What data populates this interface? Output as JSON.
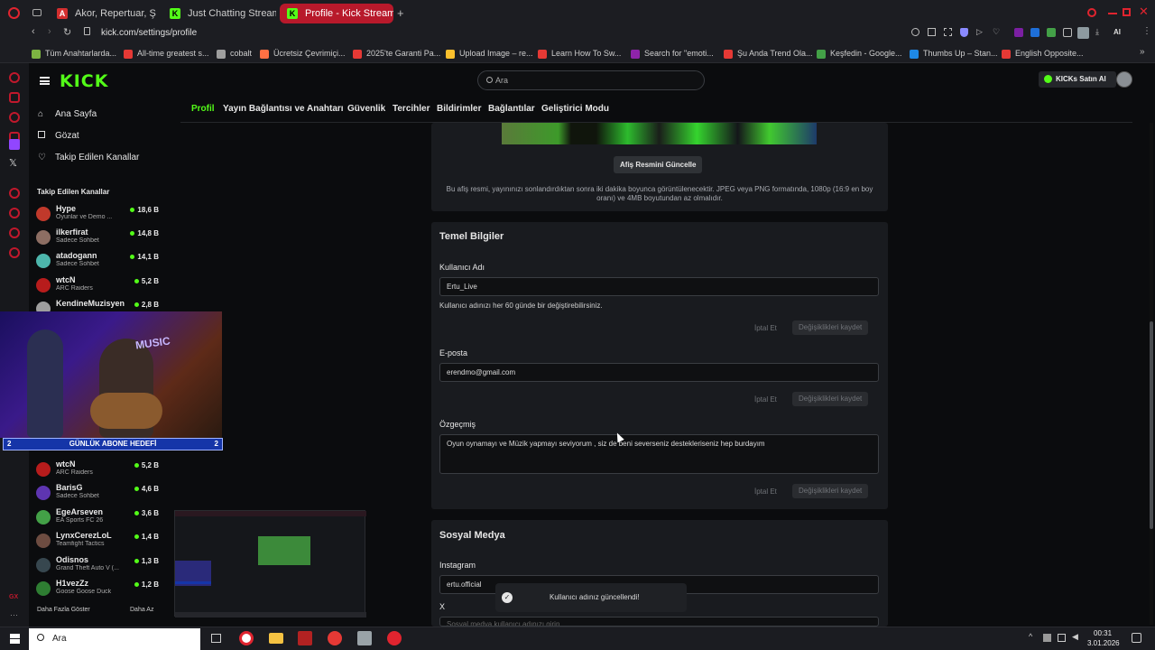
{
  "browser": {
    "tabs": [
      {
        "title": "Akor, Repertuar, Şarkı Söz",
        "icon": "a-icon",
        "color": "#d32f2f",
        "active": false
      },
      {
        "title": "Just Chatting Streaming -",
        "icon": "kick-icon",
        "color": "#53fc18",
        "active": false
      },
      {
        "title": "Profile - Kick Streaming",
        "icon": "kick-icon",
        "color": "#53fc18",
        "active": true
      }
    ],
    "url": "kick.com/settings/profile",
    "bookmarks": [
      {
        "label": "Tüm Anahtarlarda...",
        "color": "#7cb342"
      },
      {
        "label": "All-time greatest s...",
        "color": "#e53935"
      },
      {
        "label": "cobalt",
        "color": "#9e9e9e"
      },
      {
        "label": "Ücretsiz Çevrimiçi...",
        "color": "#ff7043"
      },
      {
        "label": "2025'te Garanti Pa...",
        "color": "#e53935"
      },
      {
        "label": "Upload Image – re...",
        "color": "#fbc02d"
      },
      {
        "label": "Learn How To Sw...",
        "color": "#e53935"
      },
      {
        "label": "Search for \"emoti...",
        "color": "#8e24aa"
      },
      {
        "label": "Şu Anda Trend Ola...",
        "color": "#e53935"
      },
      {
        "label": "Keşfedin - Google...",
        "color": "#43a047"
      },
      {
        "label": "Thumbs Up – Stan...",
        "color": "#1e88e5"
      },
      {
        "label": "English Opposite...",
        "color": "#e53935"
      }
    ],
    "extension_label": "AI"
  },
  "header": {
    "logo": "KICK",
    "search_placeholder": "Ara",
    "buy_kicks": "KICKs Satın Al"
  },
  "subnav": [
    "Profil",
    "Yayın Bağlantısı ve Anahtarı",
    "Güvenlik",
    "Tercihler",
    "Bildirimler",
    "Bağlantılar",
    "Geliştirici Modu"
  ],
  "sidebar": {
    "nav": [
      "Ana Sayfa",
      "Gözat",
      "Takip Edilen Kanallar"
    ],
    "section_title": "Takip Edilen Kanallar",
    "channels_top": [
      {
        "name": "Hype",
        "game": "Oyunlar ve Demo ...",
        "viewers": "18,6 B",
        "color": "#c0392b"
      },
      {
        "name": "ilkerfirat",
        "game": "Sadece Sohbet",
        "viewers": "14,8 B",
        "color": "#8d6e63"
      },
      {
        "name": "atadogann",
        "game": "Sadece Sohbet",
        "viewers": "14,1 B",
        "color": "#4db6ac"
      },
      {
        "name": "wtcN",
        "game": "ARC Raiders",
        "viewers": "5,2 B",
        "color": "#b71c1c"
      },
      {
        "name": "KendineMuzisyen",
        "game": "",
        "viewers": "2,8 B",
        "color": "#9e9e9e"
      }
    ],
    "channels_bottom": [
      {
        "name": "wtcN",
        "game": "ARC Raiders",
        "viewers": "5,2 B",
        "color": "#b71c1c"
      },
      {
        "name": "BarisG",
        "game": "Sadece Sohbet",
        "viewers": "4,6 B",
        "color": "#5e35b1"
      },
      {
        "name": "EgeArseven",
        "game": "EA Sports FC 26",
        "viewers": "3,6 B",
        "color": "#43a047"
      },
      {
        "name": "LynxCerezLoL",
        "game": "Teamfight Tactics",
        "viewers": "1,4 B",
        "color": "#6d4c41"
      },
      {
        "name": "Odisnos",
        "game": "Grand Theft Auto V (...",
        "viewers": "1,3 B",
        "color": "#37474f"
      },
      {
        "name": "H1vezZz",
        "game": "Goose Goose Duck",
        "viewers": "1,2 B",
        "color": "#2e7d32"
      }
    ],
    "show_more": "Daha Fazla Göster",
    "show_less": "Daha Az"
  },
  "overlay": {
    "goal_label": "GÜNLÜK ABONE HEDEFİ",
    "goal_left": "2",
    "goal_right": "2",
    "sign_text": "MUSIC"
  },
  "banner": {
    "update_button": "Afiş Resmini Güncelle",
    "description": "Bu afiş resmi, yayınınızı sonlandırdıktan sonra iki dakika boyunca görüntülenecektir. JPEG veya PNG formatında, 1080p (16:9 en boy oranı) ve 4MB boyutundan az olmalıdır."
  },
  "basic_info": {
    "title": "Temel Bilgiler",
    "username_label": "Kullanıcı Adı",
    "username_value": "Ertu_Live",
    "username_hint": "Kullanıcı adınızı her 60 günde bir değiştirebilirsiniz.",
    "email_label": "E-posta",
    "email_value": "erendmo@gmail.com",
    "bio_label": "Özgeçmiş",
    "bio_value": "Oyun oynamayı ve Müzik yapmayı seviyorum , siz de beni severseniz destekleriseniz hep burdayım",
    "cancel": "İptal Et",
    "save": "Değişiklikleri kaydet"
  },
  "social": {
    "title": "Sosyal Medya",
    "instagram_label": "Instagram",
    "instagram_value": "ertu.official",
    "x_label": "X",
    "x_placeholder": "Sosyal medya kullanıcı adınızı girin"
  },
  "toast": {
    "message": "Kullanıcı adınız güncellendi!"
  },
  "taskbar": {
    "search": "Ara",
    "time": "00:31",
    "date": "3.01.2026"
  }
}
